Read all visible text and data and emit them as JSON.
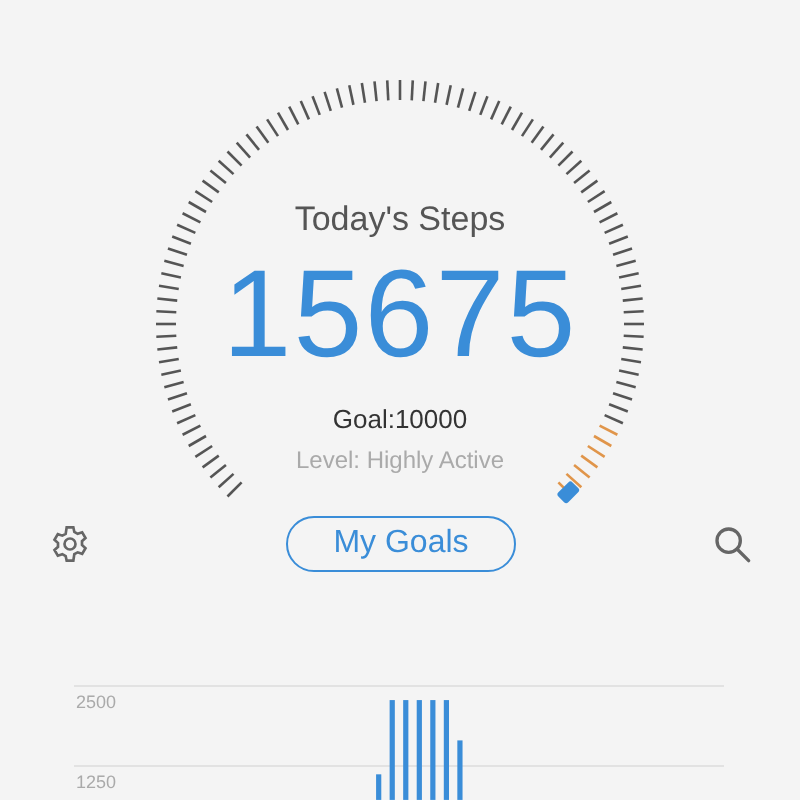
{
  "steps": {
    "title": "Today's Steps",
    "count": "15675",
    "goal": "Goal:10000",
    "level_text": "Level: Highly Active"
  },
  "actions": {
    "button": "My Goals"
  },
  "chart": {
    "chart_data": {
      "type": "bar",
      "ylim": [
        720,
        2500
      ],
      "yticks": [
        {
          "value": 1250,
          "label": "1250"
        },
        {
          "value": 2500,
          "label": "2500"
        }
      ],
      "values": [
        null,
        null,
        null,
        null,
        null,
        null,
        null,
        null,
        null,
        null,
        null,
        null,
        null,
        null,
        null,
        null,
        null,
        null,
        null,
        null,
        null,
        null,
        1120,
        2280,
        2280,
        2280,
        2280,
        2280,
        1650,
        null,
        null,
        null,
        null,
        null,
        null,
        null,
        null,
        null,
        null,
        null,
        null,
        null,
        null,
        null,
        null,
        null,
        null,
        null
      ]
    }
  }
}
